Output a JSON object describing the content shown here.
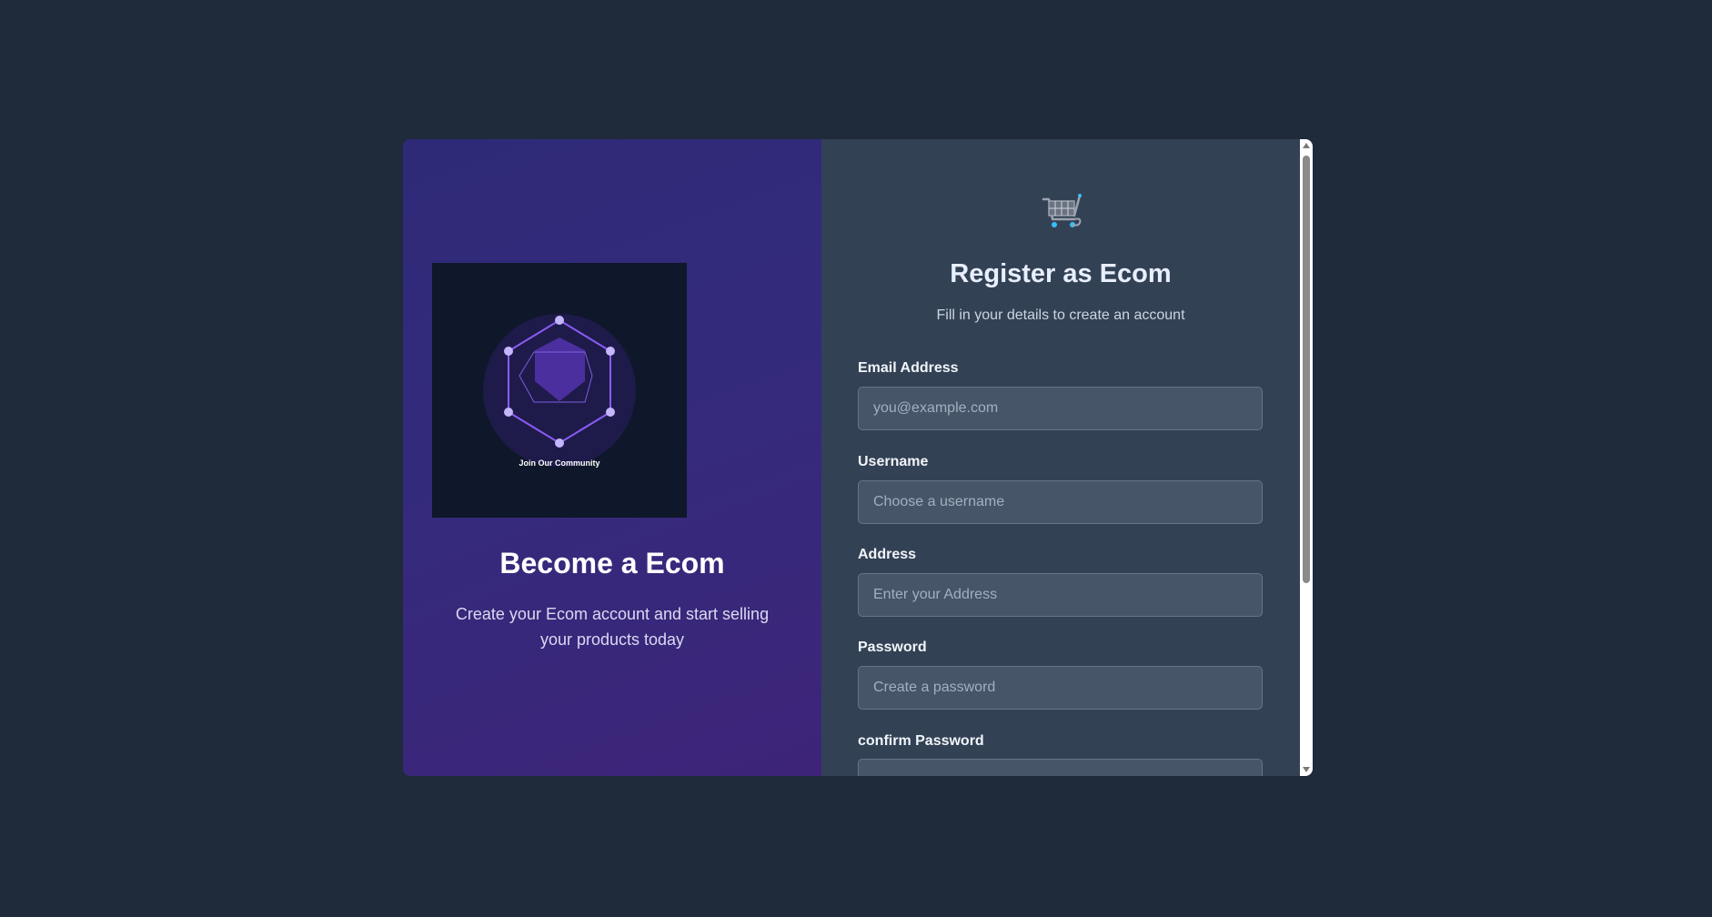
{
  "left_panel": {
    "illustration_caption": "Join Our Community",
    "title": "Become a Ecom",
    "description": "Create your Ecom account and start selling your products today"
  },
  "form": {
    "icon": "shopping-cart-icon",
    "title": "Register as Ecom",
    "subtitle": "Fill in your details to create an account",
    "fields": {
      "email": {
        "label": "Email Address",
        "placeholder": "you@example.com",
        "value": ""
      },
      "username": {
        "label": "Username",
        "placeholder": "Choose a username",
        "value": ""
      },
      "address": {
        "label": "Address",
        "placeholder": "Enter your Address",
        "value": ""
      },
      "password": {
        "label": "Password",
        "placeholder": "Create a password",
        "value": ""
      },
      "confirm_password": {
        "label": "confirm Password",
        "placeholder": "",
        "value": ""
      }
    }
  },
  "colors": {
    "page_bg": "#1f2a3b",
    "left_gradient_start": "#2e2a78",
    "left_gradient_end": "#3d2479",
    "form_bg": "#334155",
    "input_bg": "#475569",
    "accent": "#8b5cf6"
  }
}
